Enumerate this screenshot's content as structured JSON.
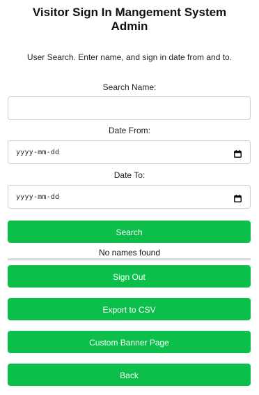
{
  "header": {
    "title_line1": "Visitor Sign In Mangement System",
    "title_line2": "Admin"
  },
  "instructions": "User Search. Enter name, and sign in date from and to.",
  "search_form": {
    "name_label": "Search Name:",
    "name_value": "",
    "name_placeholder": "",
    "date_from_label": "Date From:",
    "date_from_placeholder": "yyyy-mm-dd",
    "date_to_label": "Date To:",
    "date_to_placeholder": "yyyy-mm-dd",
    "search_button_label": "Search"
  },
  "results": {
    "status_text": "No names found"
  },
  "actions": {
    "sign_out_label": "Sign Out",
    "export_csv_label": "Export to CSV",
    "custom_banner_label": "Custom Banner Page",
    "back_label": "Back"
  },
  "icons": {
    "date_picker": "calendar-icon"
  },
  "colors": {
    "button_bg": "#0bbf4a",
    "button_text": "#ffffff",
    "input_border": "#cfcfcf",
    "divider": "#d9d9d9"
  }
}
